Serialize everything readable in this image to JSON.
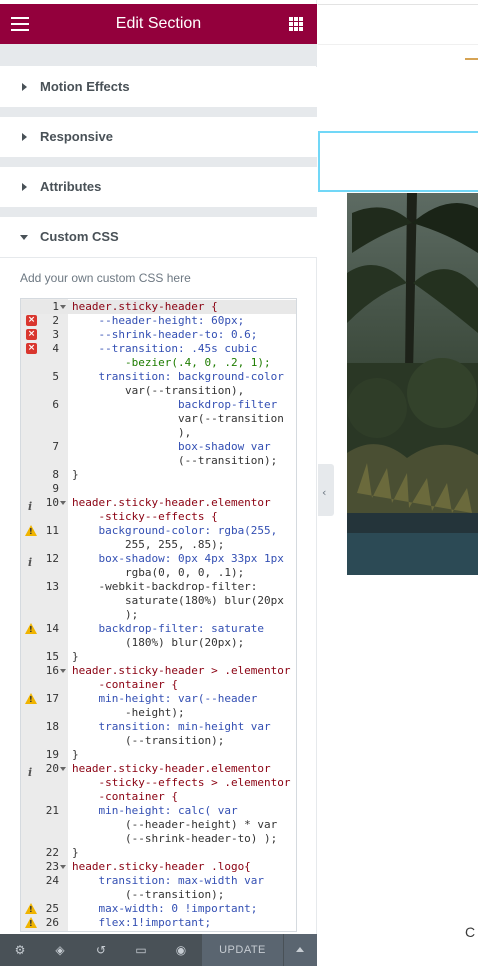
{
  "panel": {
    "title": "Edit Section",
    "sections": [
      {
        "label": "Motion Effects"
      },
      {
        "label": "Responsive"
      },
      {
        "label": "Attributes"
      },
      {
        "label": "Custom CSS"
      }
    ],
    "custom_css_description": "Add your own custom CSS here"
  },
  "editor": {
    "lines": [
      {
        "n": "1",
        "fold": true
      },
      {
        "n": "2",
        "annotation": "error"
      },
      {
        "n": "3",
        "annotation": "error"
      },
      {
        "n": "4",
        "annotation": "error"
      },
      {
        "n": "5"
      },
      {
        "n": "6"
      },
      {
        "n": "7"
      },
      {
        "n": "8"
      },
      {
        "n": "9"
      },
      {
        "n": "10",
        "fold": true,
        "annotation": "info"
      },
      {
        "n": "11",
        "annotation": "warning"
      },
      {
        "n": "12",
        "annotation": "info"
      },
      {
        "n": "13"
      },
      {
        "n": "14",
        "annotation": "warning"
      },
      {
        "n": "15"
      },
      {
        "n": "16",
        "fold": true
      },
      {
        "n": "17",
        "annotation": "warning"
      },
      {
        "n": "18"
      },
      {
        "n": "19"
      },
      {
        "n": "20",
        "fold": true,
        "annotation": "info"
      },
      {
        "n": "21"
      },
      {
        "n": "22"
      },
      {
        "n": "23",
        "fold": true
      },
      {
        "n": "24"
      },
      {
        "n": "25",
        "annotation": "warning"
      },
      {
        "n": "26",
        "annotation": "warning"
      }
    ],
    "text": {
      "l1": "header.sticky-header {",
      "l2": "    --header-height: 60px;",
      "l3": "    --shrink-header-to: 0.6;",
      "l4a": "    --transition: .45s cubic",
      "l4b": "        -bezier(.4, 0, .2, 1);",
      "l5a": "    transition: background-color",
      "l5b": "        var(--transition),",
      "l6a": "                backdrop-filter",
      "l6b": "                var(--transition",
      "l6c": "                ),",
      "l7a": "                box-shadow var",
      "l7b": "                (--transition);",
      "l8": "}",
      "l10a": "header.sticky-header.elementor",
      "l10b": "    -sticky--effects {",
      "l11a": "    background-color: rgba(255,",
      "l11b": "        255, 255, .85);",
      "l12a": "    box-shadow: 0px 4px 33px 1px",
      "l12b": "        rgba(0, 0, 0, .1);",
      "l13a": "    -webkit-backdrop-filter:",
      "l13b": "        saturate(180%) blur(20px",
      "l13c": "        );",
      "l14a": "    backdrop-filter: saturate",
      "l14b": "        (180%) blur(20px);",
      "l15": "}",
      "l16a": "header.sticky-header > .elementor",
      "l16b": "    -container {",
      "l17a": "    min-height: var(--header",
      "l17b": "        -height);",
      "l18a": "    transition: min-height var",
      "l18b": "        (--transition);",
      "l19": "}",
      "l20a": "header.sticky-header.elementor",
      "l20b": "    -sticky--effects > .elementor",
      "l20c": "    -container {",
      "l21a": "    min-height: calc( var",
      "l21b": "        (--header-height) * var",
      "l21c": "        (--shrink-header-to) );",
      "l22": "}",
      "l23": "header.sticky-header .logo{",
      "l24a": "    transition: max-width var",
      "l24b": "        (--transition);",
      "l25": "    max-width: 0 !important;",
      "l26": "    flex:1!important;"
    }
  },
  "footer": {
    "icons": [
      "settings-icon",
      "layers-icon",
      "history-icon",
      "responsive-icon",
      "preview-eye-icon"
    ],
    "update_label": "UPDATE"
  },
  "preview": {
    "bottom_text": "C"
  },
  "colors": {
    "brand": "#93003c",
    "footer": "#495157",
    "selected_outline": "#71d7f7"
  }
}
